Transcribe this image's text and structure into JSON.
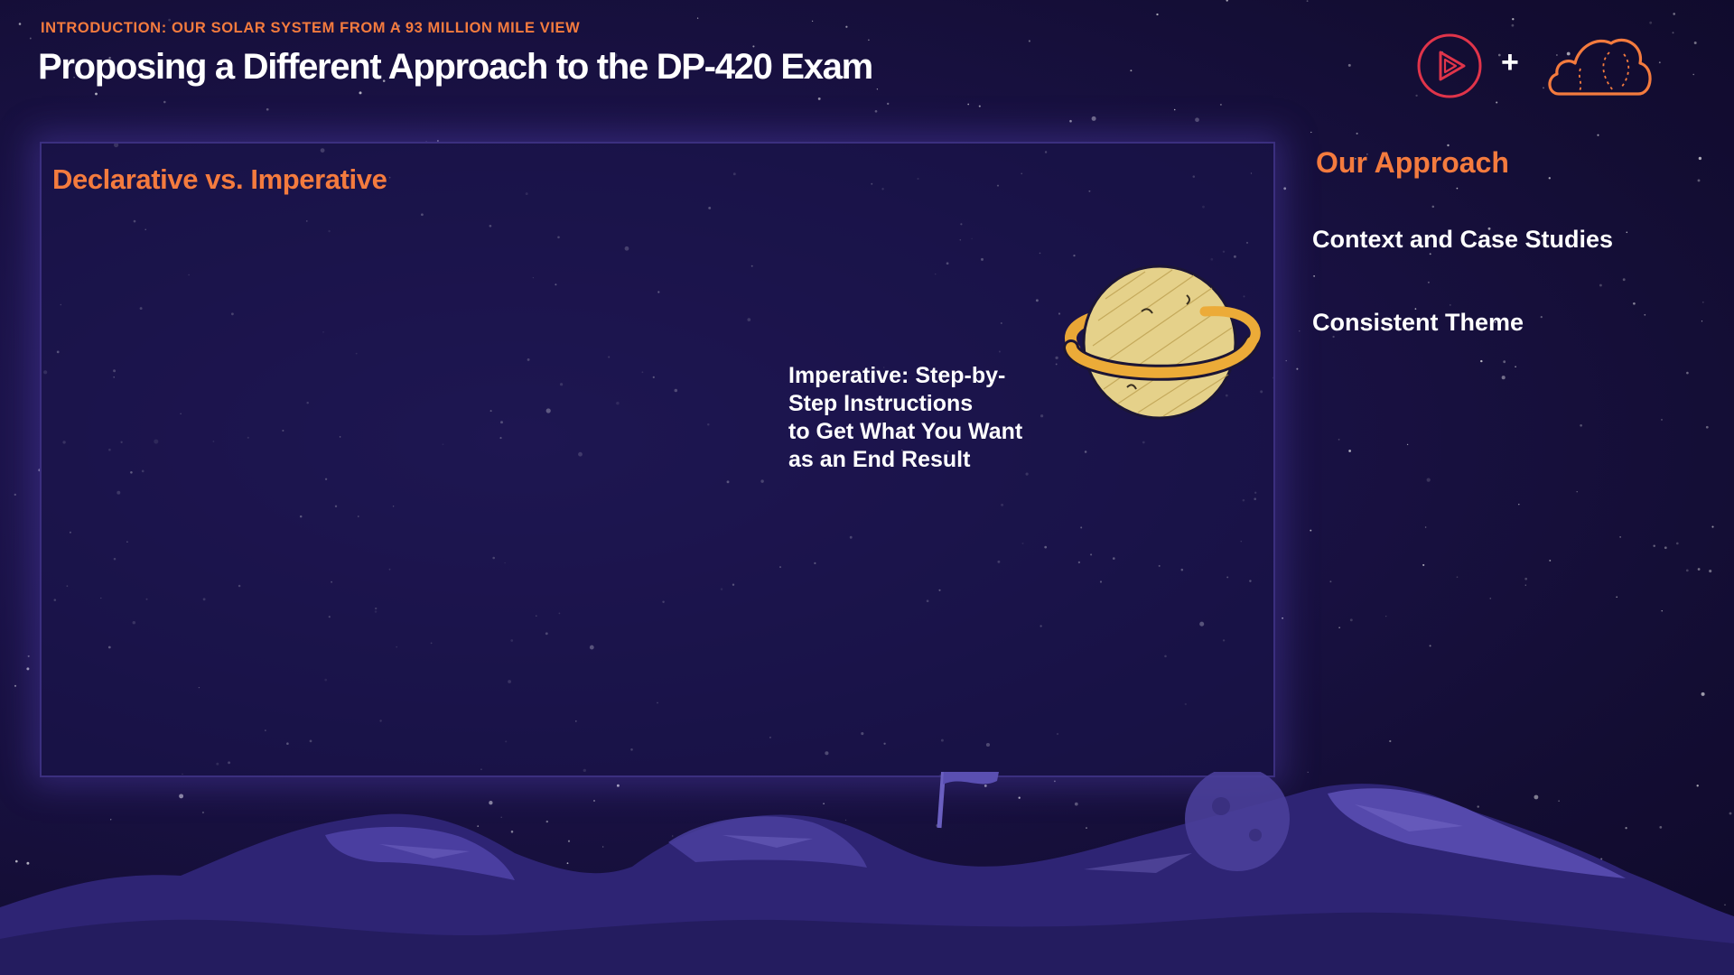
{
  "slide": {
    "eyebrow": "INTRODUCTION: OUR SOLAR SYSTEM FROM A 93 MILLION MILE VIEW",
    "title": "Proposing a Different Approach to the DP-420 Exam"
  },
  "branding": {
    "plus": "+",
    "logos": [
      "play-logo-icon",
      "cloud-logo-icon"
    ],
    "accent_color": "#f47b3e",
    "play_logo_color": "#e0344a"
  },
  "panel": {
    "heading": "Declarative vs. Imperative",
    "imperative_text": "Imperative: Step-by-\nStep Instructions\nto Get What You Want\nas an End Result",
    "illustration": "ringed-planet-icon"
  },
  "sidebar": {
    "heading": "Our Approach",
    "items": [
      {
        "label": "Context and Case Studies"
      },
      {
        "label": "Consistent Theme"
      }
    ]
  },
  "background": {
    "scene": "starfield with moon surface",
    "base_color": "#150f34"
  }
}
